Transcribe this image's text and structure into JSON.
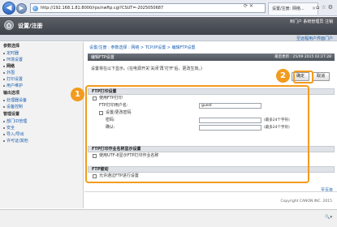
{
  "browser": {
    "url": "http://192.168.1.81:8000/rps/nwftp.cgi?CSUT=-2025050687",
    "tab_title": "设置/注册: 网络..."
  },
  "header": {
    "title": "设置/注册",
    "links": "到门户  系统管理员  注销",
    "portal_link": "至远程用户界面门户"
  },
  "sidebar": {
    "sections": [
      {
        "heading": "参数选择",
        "items": [
          "定时器",
          "环境设置",
          "网络",
          "外围",
          "打印设置",
          "用户维护"
        ]
      },
      {
        "heading": "输出选项",
        "items": [
          "处理器设备",
          "设备控制"
        ]
      },
      {
        "heading": "管理设置",
        "items": [
          "部门ID管理",
          "安全",
          "导入/导出",
          "许可证/其他"
        ]
      }
    ],
    "active": "网络"
  },
  "main": {
    "breadcrumb": "设置/注册 : 参数选择 : 网络 > TCP/IP设置 > 编辑FTP设置",
    "page_title": "编辑FTP设置",
    "last_updated": "最后更新 : 25/09 2015 02:27:28",
    "description": "设置将在以下显示。(在电源开关'关闭'再'打开'后，更改生效。)",
    "ok_button": "确定",
    "cancel_button": "取消"
  },
  "ftp_print": {
    "heading": "FTP打印设置",
    "use_ftp_print": "使用FTP打印",
    "username_label": "FTP打印用户名:",
    "username_value": "guest",
    "set_password": "设置/更改密码",
    "password_label": "密码:",
    "confirm_label": "确认:",
    "hint": "(最多24个字符)"
  },
  "ftp_extension": {
    "heading": "FTP打印作业名称显示设置",
    "use_utf8": "使用UTF-8显示FTP打印作业名称"
  },
  "ftp_pasv": {
    "heading": "FTP被动",
    "allow_pasv": "允许通过FTP进行设置"
  },
  "footer": {
    "top_link": "至页首",
    "copyright": "Copyright CANON INC. 2015"
  },
  "callouts": {
    "one": "1",
    "two": "2"
  }
}
